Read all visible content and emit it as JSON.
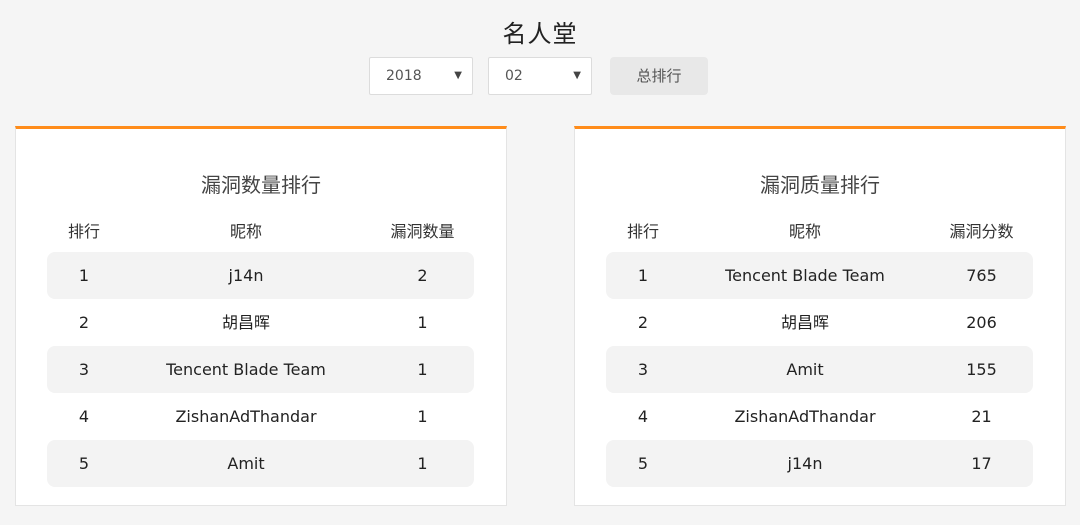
{
  "page": {
    "title": "名人堂"
  },
  "filters": {
    "year": "2018",
    "month": "02",
    "total_button": "总排行",
    "arrow_glyph": "▼"
  },
  "left_panel": {
    "title": "漏洞数量排行",
    "headers": [
      "排行",
      "昵称",
      "漏洞数量"
    ],
    "rows": [
      {
        "rank": "1",
        "name": "j14n",
        "value": "2"
      },
      {
        "rank": "2",
        "name": "胡昌晖",
        "value": "1"
      },
      {
        "rank": "3",
        "name": "Tencent Blade Team",
        "value": "1"
      },
      {
        "rank": "4",
        "name": "ZishanAdThandar",
        "value": "1"
      },
      {
        "rank": "5",
        "name": "Amit",
        "value": "1"
      }
    ]
  },
  "right_panel": {
    "title": "漏洞质量排行",
    "headers": [
      "排行",
      "昵称",
      "漏洞分数"
    ],
    "rows": [
      {
        "rank": "1",
        "name": "Tencent Blade Team",
        "value": "765"
      },
      {
        "rank": "2",
        "name": "胡昌晖",
        "value": "206"
      },
      {
        "rank": "3",
        "name": "Amit",
        "value": "155"
      },
      {
        "rank": "4",
        "name": "ZishanAdThandar",
        "value": "21"
      },
      {
        "rank": "5",
        "name": "j14n",
        "value": "17"
      }
    ]
  },
  "colors": {
    "accent": "#ff8c1a",
    "background": "#f5f5f5",
    "row_shade": "#f3f3f3"
  }
}
